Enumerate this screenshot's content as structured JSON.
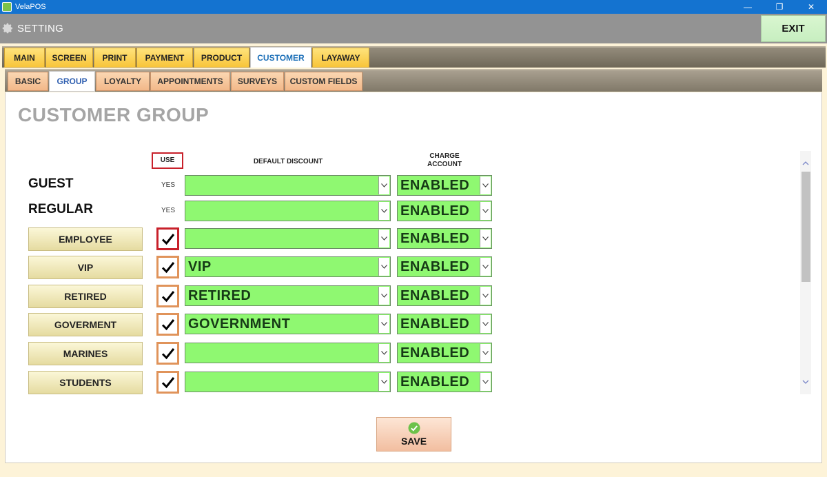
{
  "app": {
    "title": "VelaPOS"
  },
  "header": {
    "title": "SETTING",
    "exit_label": "EXIT"
  },
  "main_tabs": [
    {
      "label": "MAIN"
    },
    {
      "label": "SCREEN"
    },
    {
      "label": "PRINT"
    },
    {
      "label": "PAYMENT"
    },
    {
      "label": "PRODUCT"
    },
    {
      "label": "CUSTOMER",
      "active": true
    },
    {
      "label": "LAYAWAY"
    }
  ],
  "sub_tabs": [
    {
      "label": "BASIC"
    },
    {
      "label": "GROUP",
      "active": true
    },
    {
      "label": "LOYALTY"
    },
    {
      "label": "APPOINTMENTS"
    },
    {
      "label": "SURVEYS"
    },
    {
      "label": "CUSTOM FIELDS"
    }
  ],
  "page": {
    "heading": "CUSTOMER GROUP",
    "col_use": "USE",
    "col_discount": "DEFAULT DISCOUNT",
    "col_charge_line1": "CHARGE",
    "col_charge_line2": "ACCOUNT"
  },
  "groups": {
    "guest": {
      "name": "GUEST",
      "use": "YES",
      "discount": "",
      "charge": "ENABLED"
    },
    "regular": {
      "name": "REGULAR",
      "use": "YES",
      "discount": "",
      "charge": "ENABLED"
    },
    "employee": {
      "name": "EMPLOYEE",
      "checked": true,
      "discount": "",
      "charge": "ENABLED"
    },
    "vip": {
      "name": "VIP",
      "checked": true,
      "discount": "VIP",
      "charge": "ENABLED"
    },
    "retired": {
      "name": "RETIRED",
      "checked": true,
      "discount": "RETIRED",
      "charge": "ENABLED"
    },
    "goverment": {
      "name": "GOVERMENT",
      "checked": true,
      "discount": "GOVERNMENT",
      "charge": "ENABLED"
    },
    "marines": {
      "name": "MARINES",
      "checked": true,
      "discount": "",
      "charge": "ENABLED"
    },
    "students": {
      "name": "STUDENTS",
      "checked": true,
      "discount": "",
      "charge": "ENABLED"
    }
  },
  "save": {
    "label": "SAVE"
  },
  "colors": {
    "select_bg": "#8ff871",
    "main_tab": "#f8c53a",
    "sub_tab": "#f2b889",
    "title_bar": "#1473d0",
    "focus_border": "#c8202a",
    "check_border": "#e0935a"
  },
  "icons": {
    "app": "app-icon",
    "settings": "gear-icon",
    "save": "check-circle-icon",
    "dropdown": "chevron-down-icon"
  }
}
